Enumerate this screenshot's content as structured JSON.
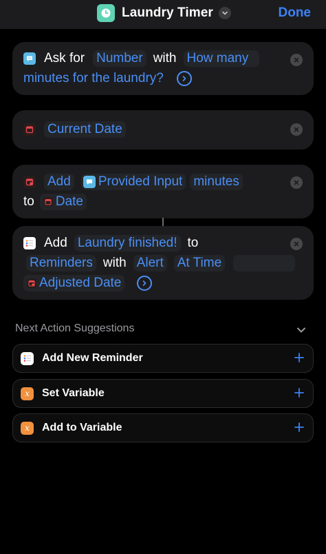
{
  "header": {
    "title": "Laundry Timer",
    "done_label": "Done",
    "app_icon": "timer-icon",
    "accent": "#3b82f6",
    "app_icon_color": "#5fd3b4"
  },
  "actions": [
    {
      "type": "ask-for-input",
      "words": {
        "ask_for": "Ask for",
        "with": "with"
      },
      "tokens": {
        "input_type": "Number",
        "prompt_line1": "How many",
        "prompt_line2": "minutes for the laundry?"
      }
    },
    {
      "type": "current-date",
      "tokens": {
        "current_date": "Current Date"
      }
    },
    {
      "type": "adjust-date",
      "words": {
        "minutes": "minutes",
        "to": "to"
      },
      "tokens": {
        "operation": "Add",
        "provided_input": "Provided Input",
        "date": "Date"
      }
    },
    {
      "type": "add-reminder",
      "words": {
        "add": "Add",
        "to": "to",
        "with": "with"
      },
      "tokens": {
        "title": "Laundry finished!",
        "list": "Reminders",
        "alert": "Alert",
        "at_time": "At Time",
        "adjusted_date": "Adjusted Date"
      }
    }
  ],
  "suggestions": {
    "title": "Next Action Suggestions",
    "items": [
      {
        "label": "Add New Reminder",
        "icon": "reminders-icon"
      },
      {
        "label": "Set Variable",
        "icon": "variable-icon"
      },
      {
        "label": "Add to Variable",
        "icon": "variable-icon"
      }
    ]
  },
  "colors": {
    "background": "#000000",
    "card": "#1c1c1e",
    "token_text": "#4a8ff7",
    "calendar_red": "#e5484d",
    "variable_orange": "#f2913d",
    "input_blue": "#5bb8e6"
  }
}
